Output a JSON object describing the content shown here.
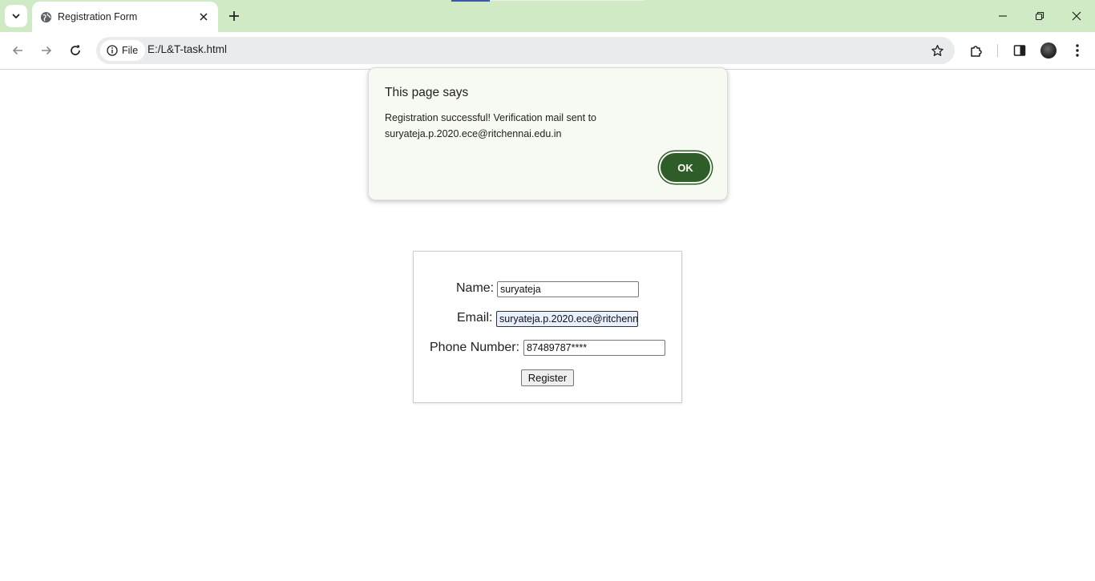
{
  "browser": {
    "tab_title": "Registration Form",
    "address_chip": "File",
    "url": "E:/L&T-task.html"
  },
  "dialog": {
    "title": "This page says",
    "message_line1": "Registration successful! Verification mail sent to",
    "message_line2": "suryateja.p.2020.ece@ritchennai.edu.in",
    "ok_label": "OK"
  },
  "form": {
    "name_label": "Name:",
    "name_value": "suryateja",
    "email_label": "Email:",
    "email_value": "suryateja.p.2020.ece@ritchennai.edu.in",
    "phone_label": "Phone Number:",
    "phone_value": "87489787****",
    "register_label": "Register"
  },
  "colors": {
    "tabstrip_bg": "#cfeac4",
    "ok_button": "#2f5d29",
    "dialog_bg": "#f7faf2"
  }
}
